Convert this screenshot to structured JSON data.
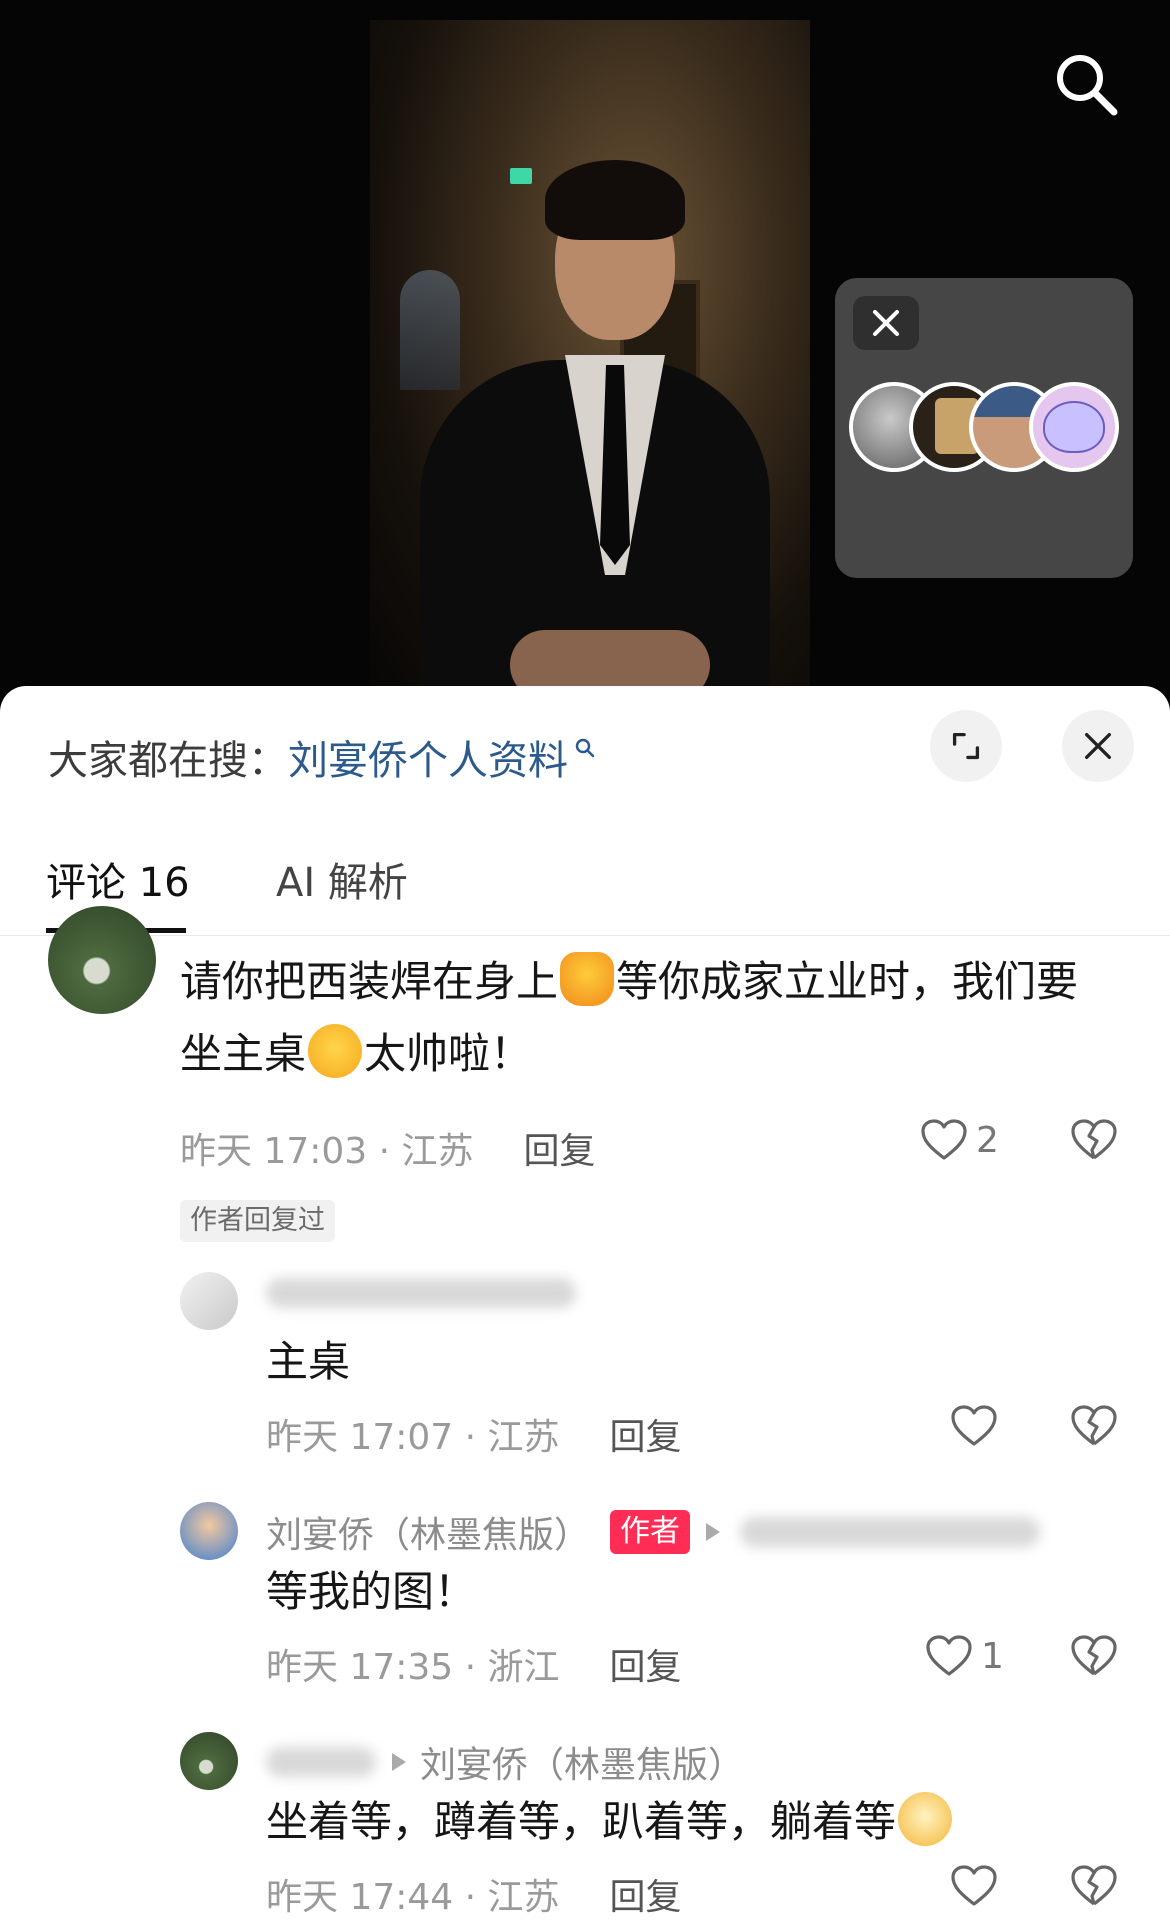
{
  "colors": {
    "accent_link": "#2d5a8c",
    "author_badge": "#ff2d55",
    "meta_gray": "#9a9a9a"
  },
  "hot_search": {
    "prefix": "大家都在搜：",
    "keyword": "刘宴侨个人资料"
  },
  "tabs": [
    {
      "label": "评论 16"
    },
    {
      "label": "AI 解析"
    }
  ],
  "comment": {
    "text_part1": "请你把西装焊在身上",
    "text_part2": "等你成家立业时，我们要坐主桌",
    "text_part3": "太帅啦！",
    "time": "昨天 17:03 · 江苏",
    "reply_label": "回复",
    "likes": "2",
    "author_replied_tag": "作者回复过"
  },
  "replies": [
    {
      "text": "主桌",
      "time": "昨天 17:07 · 江苏",
      "reply_label": "回复",
      "likes": ""
    },
    {
      "name": "刘宴侨（林墨焦版）",
      "badge": "作者",
      "text": "等我的图！",
      "time": "昨天 17:35 · 浙江",
      "reply_label": "回复",
      "likes": "1"
    },
    {
      "name": "刘宴侨（林墨焦版）",
      "text": "坐着等，蹲着等，趴着等，躺着等",
      "time": "昨天 17:44 · 江苏",
      "reply_label": "回复",
      "likes": ""
    }
  ]
}
